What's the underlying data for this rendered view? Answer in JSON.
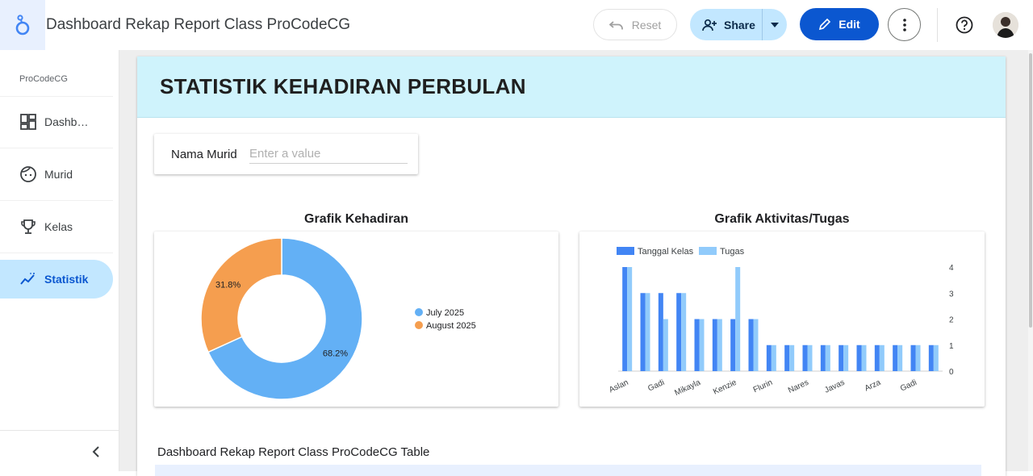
{
  "app": {
    "title": "Dashboard Rekap Report Class ProCodeCG"
  },
  "toolbar": {
    "reset_label": "Reset",
    "share_label": "Share",
    "edit_label": "Edit"
  },
  "sidebar": {
    "brand": "ProCodeCG",
    "items": [
      {
        "label": "Dashb…",
        "icon": "dashboard-icon"
      },
      {
        "label": "Murid",
        "icon": "face-icon"
      },
      {
        "label": "Kelas",
        "icon": "trophy-icon"
      },
      {
        "label": "Statistik",
        "icon": "insights-icon",
        "active": true
      }
    ]
  },
  "report": {
    "heading": "STATISTIK KEHADIRAN PERBULAN",
    "filter": {
      "label": "Nama Murid",
      "placeholder": "Enter a value",
      "value": ""
    },
    "table_title": "Dashboard Rekap Report Class ProCodeCG Table"
  },
  "colors": {
    "accent": "#0b57d0",
    "hero_bg": "#cff3fc",
    "series1": "#4285f4",
    "series2": "#91cbfb",
    "pie1": "#63b0f5",
    "pie2": "#f59e4f"
  },
  "chart_data": [
    {
      "type": "pie",
      "title": "Grafik Kehadiran",
      "donut": true,
      "categories": [
        "July 2025",
        "August 2025"
      ],
      "values": [
        68.2,
        31.8
      ],
      "labels": [
        "68.2%",
        "31.8%"
      ],
      "legend": "right",
      "colors": [
        "#63b0f5",
        "#f59e4f"
      ]
    },
    {
      "type": "bar",
      "title": "Grafik Aktivitas/Tugas",
      "categories": [
        "Aslan",
        "",
        "Gadi",
        "",
        "Mikayla",
        "",
        "Kenzie",
        "",
        "Flurin",
        "",
        "Nares",
        "",
        "Javas",
        "",
        "Arza",
        "",
        "Gadi",
        ""
      ],
      "series": [
        {
          "name": "Tanggal Kelas",
          "values": [
            4,
            3,
            3,
            3,
            2,
            2,
            2,
            2,
            1,
            1,
            1,
            1,
            1,
            1,
            1,
            1,
            1,
            1
          ]
        },
        {
          "name": "Tugas",
          "values": [
            4,
            3,
            2,
            3,
            2,
            2,
            4,
            2,
            1,
            1,
            1,
            1,
            1,
            1,
            1,
            1,
            1,
            1
          ]
        }
      ],
      "yticks": [
        "0",
        "1",
        "2",
        "3",
        "4"
      ],
      "ylim": [
        0,
        4
      ],
      "legend": "top-left",
      "colors": [
        "#4285f4",
        "#91cbfb"
      ]
    }
  ]
}
